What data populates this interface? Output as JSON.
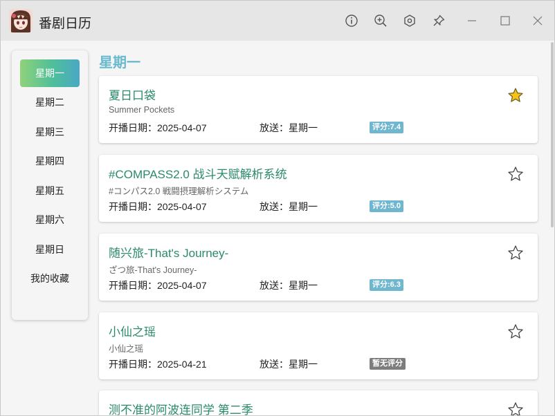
{
  "titlebar": {
    "title": "番剧日历",
    "icons": [
      "info-icon",
      "zoom-in-icon",
      "settings-icon",
      "pin-icon",
      "minimize-icon",
      "maximize-icon",
      "close-icon"
    ]
  },
  "sidebar": {
    "items": [
      {
        "label": "星期一",
        "active": true
      },
      {
        "label": "星期二",
        "active": false
      },
      {
        "label": "星期三",
        "active": false
      },
      {
        "label": "星期四",
        "active": false
      },
      {
        "label": "星期五",
        "active": false
      },
      {
        "label": "星期六",
        "active": false
      },
      {
        "label": "星期日",
        "active": false
      },
      {
        "label": "我的收藏",
        "active": false
      }
    ]
  },
  "main": {
    "heading": "星期一",
    "cards": [
      {
        "title": "夏日口袋",
        "subtitle": "Summer Pockets",
        "date_text": "开播日期：2025-04-07",
        "air_text": "放送：星期一",
        "rating_text": "评分:7.4",
        "rated": true,
        "favorited": true
      },
      {
        "title": "#COMPASS2.0 战斗天赋解析系统",
        "subtitle": "#コンパス2.0 戦闘摂理解析システム",
        "date_text": "开播日期：2025-04-07",
        "air_text": "放送：星期一",
        "rating_text": "评分:5.0",
        "rated": true,
        "favorited": false
      },
      {
        "title": "随兴旅-That's Journey-",
        "subtitle": "ざつ旅-That's Journey-",
        "date_text": "开播日期：2025-04-07",
        "air_text": "放送：星期一",
        "rating_text": "评分:6.3",
        "rated": true,
        "favorited": false
      },
      {
        "title": "小仙之瑶",
        "subtitle": "小仙之瑶",
        "date_text": "开播日期：2025-04-21",
        "air_text": "放送：星期一",
        "rating_text": "暂无评分",
        "rated": false,
        "favorited": false
      },
      {
        "title": "测不准的阿波连同学 第二季",
        "subtitle": "",
        "date_text": "",
        "air_text": "",
        "rating_text": "",
        "rated": false,
        "favorited": false
      }
    ]
  },
  "colors": {
    "accent_heading": "#69b9cf",
    "card_title": "#2a8a6a",
    "badge_rated": "#6fb6cf",
    "badge_unrated": "#7d7d7d",
    "star_fill": "#f3c316"
  }
}
